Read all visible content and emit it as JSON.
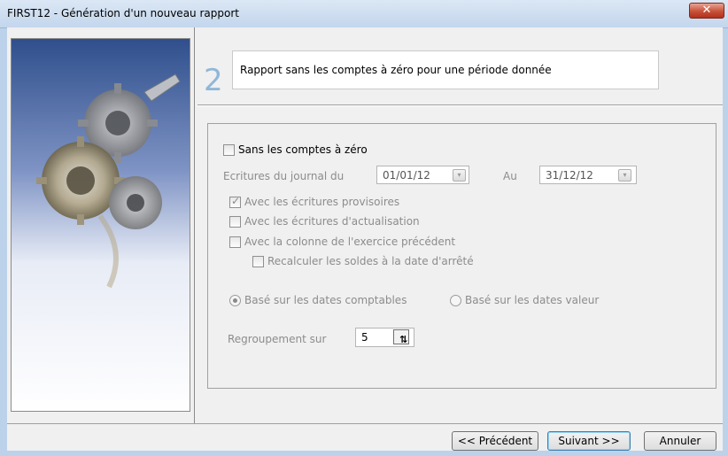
{
  "window": {
    "title": "FIRST12 - Génération d'un nouveau rapport",
    "close_label": "✕"
  },
  "step": {
    "number": "2",
    "description": "Rapport sans les comptes à zéro pour une  période donnée"
  },
  "options": {
    "sans_comptes_zero": {
      "label": "Sans les comptes à zéro",
      "checked": false
    },
    "ecritures_du_label": "Ecritures du journal du",
    "date_from": "01/01/12",
    "au_label": "Au",
    "date_to": "31/12/12",
    "provisoires": {
      "label": "Avec les écritures provisoires",
      "checked": true
    },
    "actualisation": {
      "label": "Avec les écritures d'actualisation",
      "checked": false
    },
    "exercice_precedent": {
      "label": "Avec la colonne de l'exercice précédent",
      "checked": false
    },
    "recalculer": {
      "label": "Recalculer les soldes à la date d'arrêté",
      "checked": false
    },
    "dates_comptables": {
      "label": "Basé sur les dates comptables",
      "selected": true
    },
    "dates_valeur": {
      "label": "Basé sur les dates valeur",
      "selected": false
    },
    "regroupement_label": "Regroupement sur",
    "regroupement_value": "5"
  },
  "buttons": {
    "previous": "<< Précédent",
    "next": "Suivant >>",
    "cancel": "Annuler"
  },
  "colors": {
    "titlebar": "#c3d6ec",
    "step_number": "#8fb7d9",
    "dialog_bg": "#f0f0f0",
    "close": "#c7513a"
  }
}
